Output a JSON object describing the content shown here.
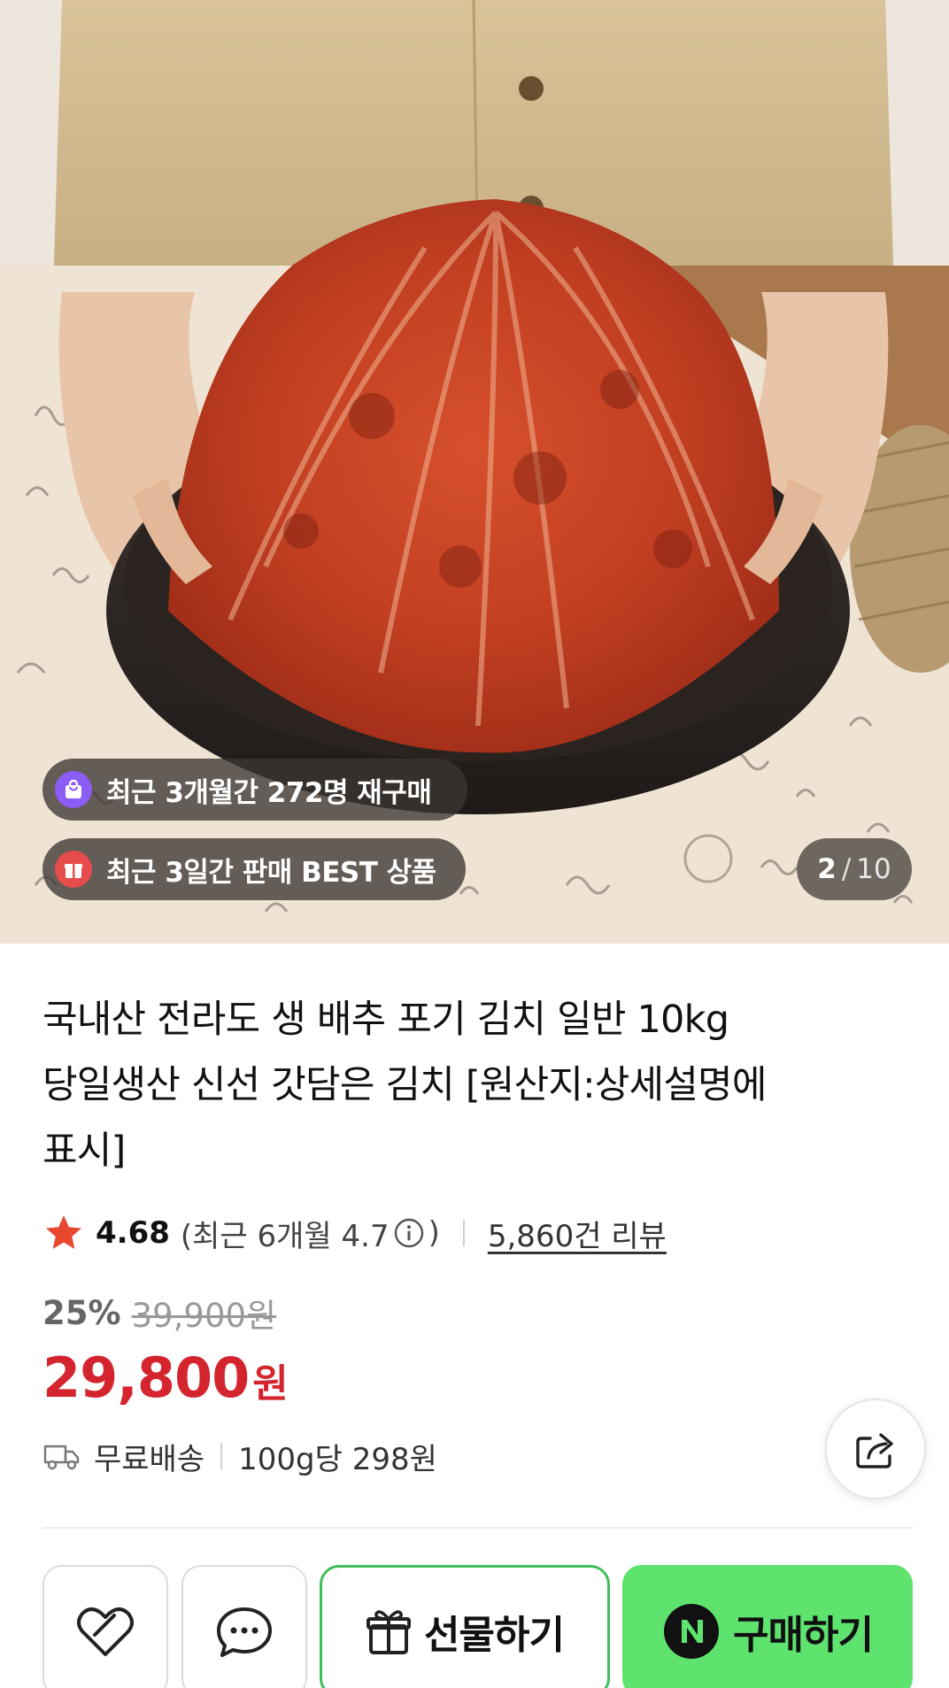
{
  "hero": {
    "image_alt": "kimchi-in-bowl-photo",
    "badges": [
      {
        "icon": "shopping-bag-icon",
        "icon_color": "#8b5cf6",
        "text": "최근 3개월간 272명 재구매"
      },
      {
        "icon": "gift-box-icon",
        "icon_color": "#e74c4c",
        "text": "최근 3일간 판매 BEST 상품"
      }
    ],
    "counter": {
      "current": "2",
      "separator": "/",
      "total": "10"
    }
  },
  "product": {
    "title_lines": [
      "국내산 전라도 생 배추 포기 김치 일반 10kg",
      "당일생산 신선 갓담은 김치 [원산지:상세설명에",
      "표시]"
    ],
    "rating": {
      "score": "4.68",
      "recent_open": "(최근 6개월 4.7",
      "recent_close": ")",
      "reviews": "5,860건 리뷰",
      "star_color": "#e8472f"
    },
    "price": {
      "discount": "25%",
      "original": "39,900원",
      "sale": "29,800",
      "currency": "원",
      "sale_color": "#d4252f"
    },
    "shipping": {
      "label": "무료배송",
      "unit_price": "100g당 298원"
    }
  },
  "actions": {
    "gift_label": "선물하기",
    "buy_label": "구매하기",
    "buy_color": "#5ee36e",
    "gift_border_color": "#3fbf5a"
  }
}
